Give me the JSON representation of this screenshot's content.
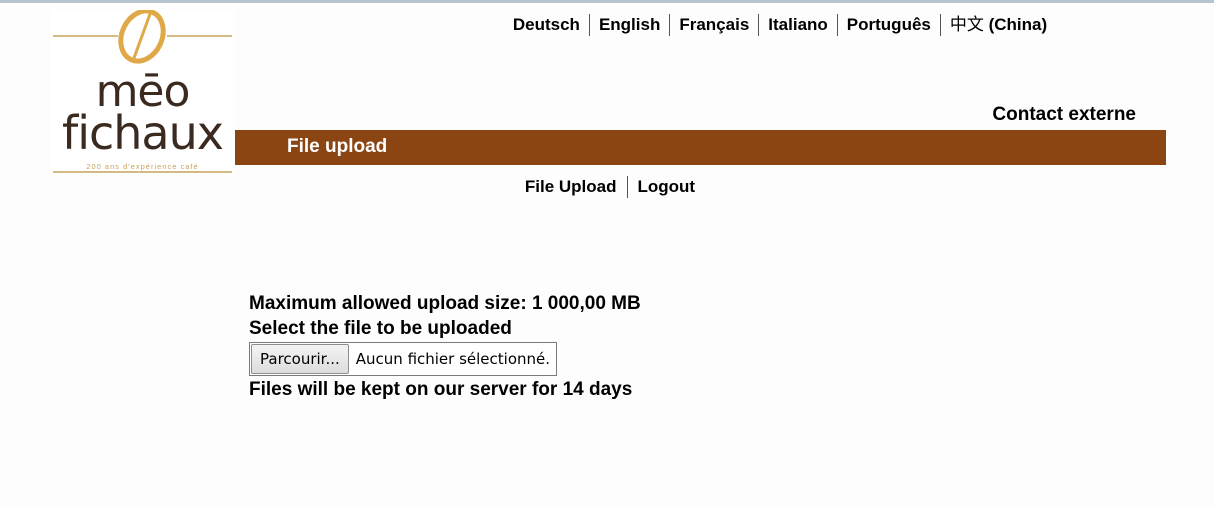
{
  "logo": {
    "name_line1": "mēo",
    "name_line2": "fichaux",
    "tagline": "200 ans d'expérience café",
    "bean_color": "#e0a948",
    "text_color": "#3a2a20"
  },
  "languages": [
    {
      "label": "Deutsch"
    },
    {
      "label": "English"
    },
    {
      "label": "Français"
    },
    {
      "label": "Italiano"
    },
    {
      "label": "Português"
    },
    {
      "label": "中文",
      "suffix": " (China)"
    }
  ],
  "header": {
    "contact_link": "Contact externe",
    "title": "File upload",
    "bar_color": "#8b4513"
  },
  "nav": {
    "items": [
      {
        "label": "File Upload"
      },
      {
        "label": "Logout"
      }
    ]
  },
  "upload": {
    "max_size_text": "Maximum allowed upload size: 1 000,00 MB",
    "select_prompt": "Select the file to be uploaded",
    "browse_button": "Parcourir...",
    "no_file_text": "Aucun fichier sélectionné.",
    "retention_text": "Files will be kept on our server for 14 days"
  }
}
